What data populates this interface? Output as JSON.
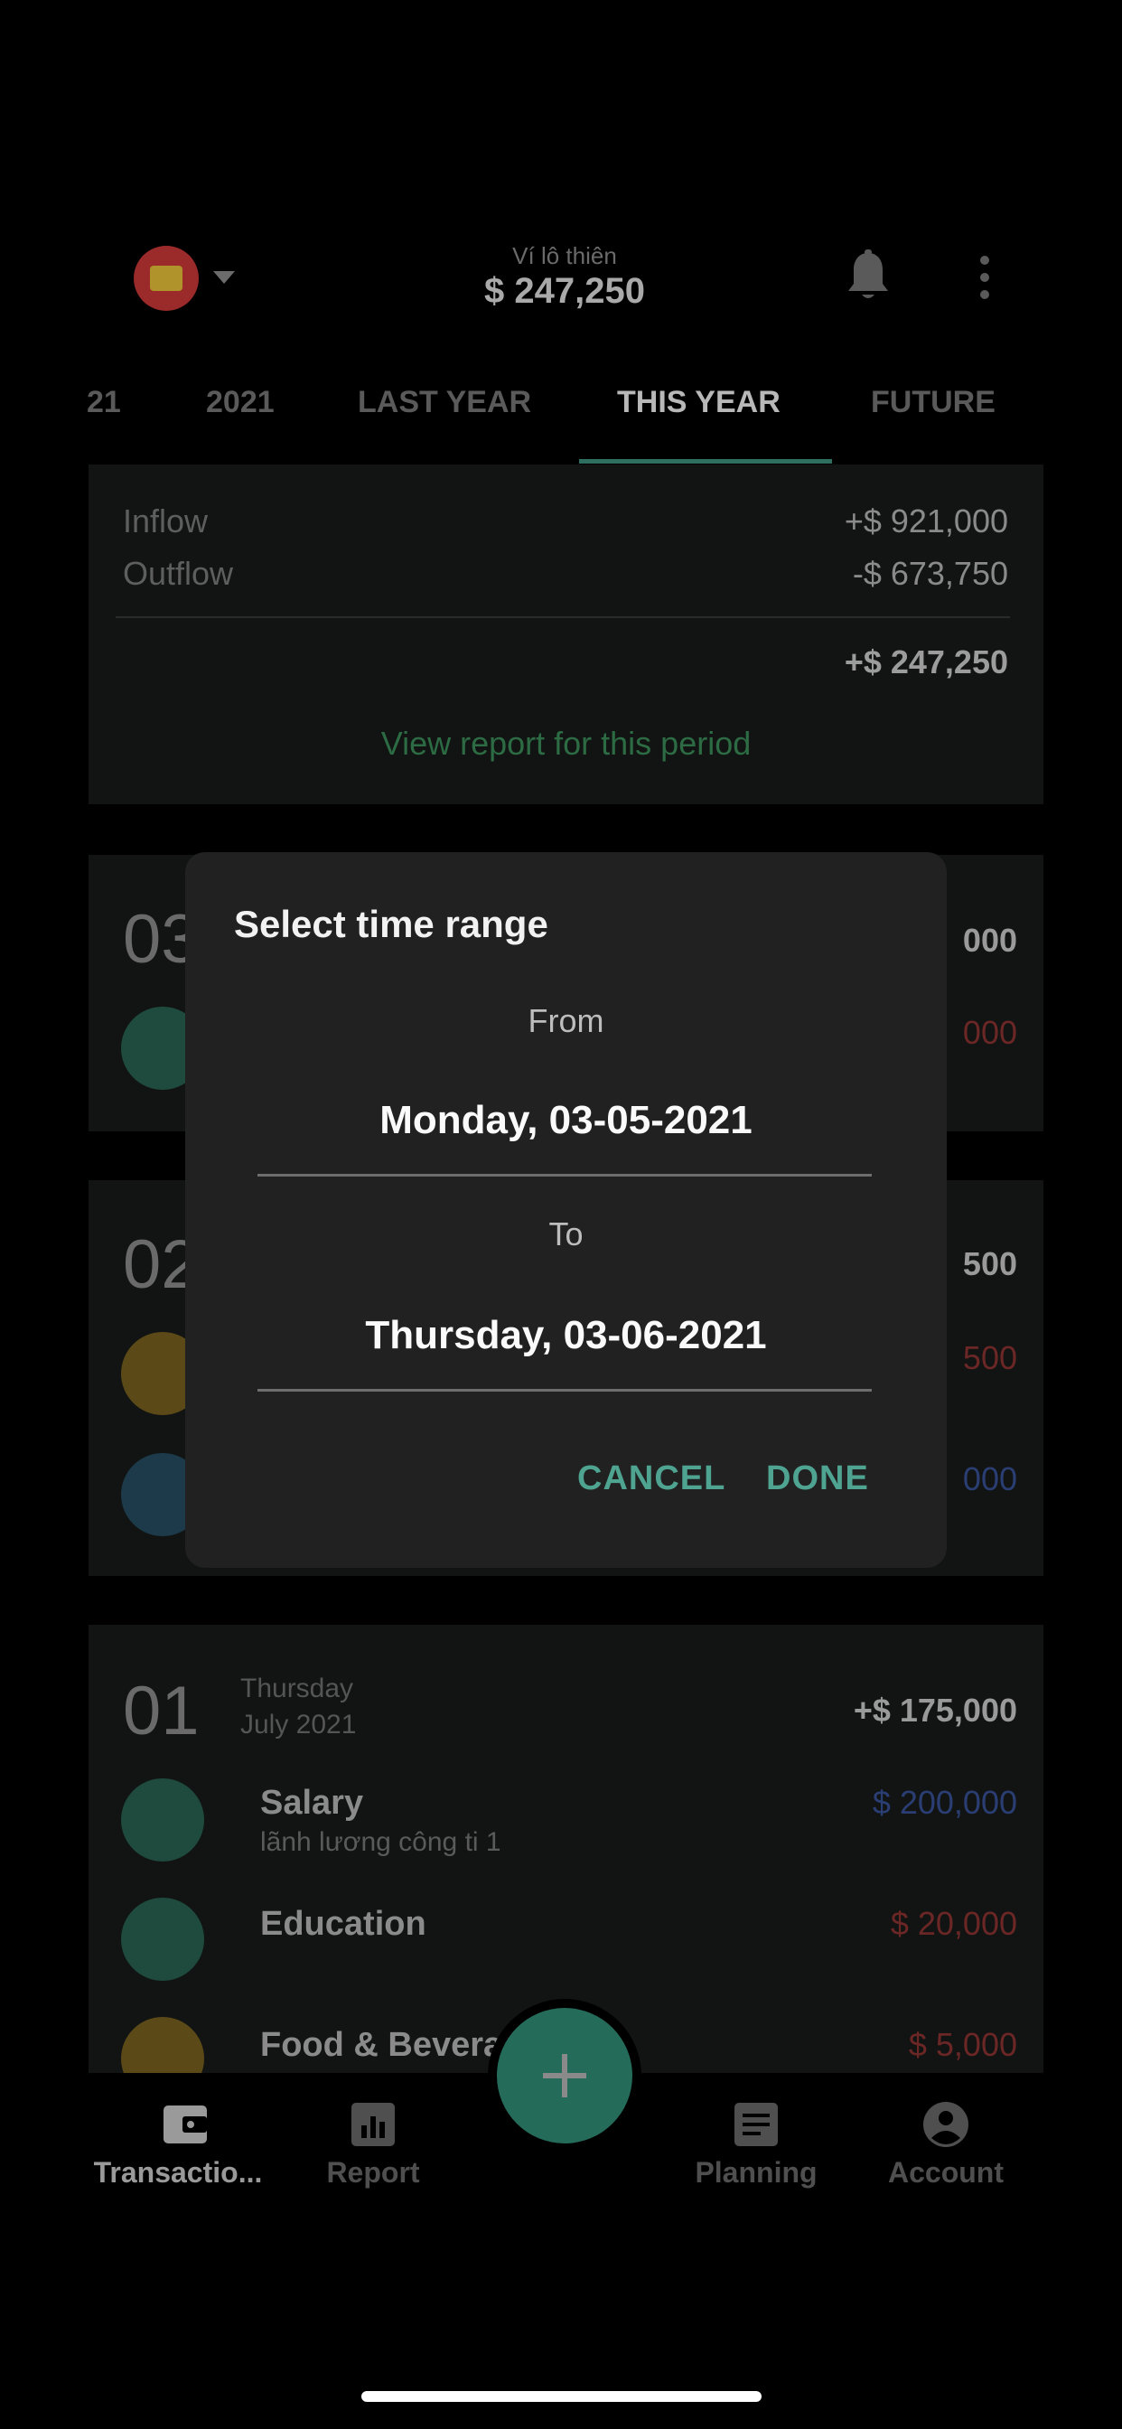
{
  "header": {
    "wallet_name": "Ví lô thiên",
    "wallet_balance": "$ 247,250"
  },
  "tabs": [
    {
      "label": "21"
    },
    {
      "label": "2021"
    },
    {
      "label": "LAST YEAR"
    },
    {
      "label": "THIS YEAR",
      "active": true
    },
    {
      "label": "FUTURE"
    }
  ],
  "summary": {
    "inflow_label": "Inflow",
    "inflow_value": "+$ 921,000",
    "outflow_label": "Outflow",
    "outflow_value": "-$ 673,750",
    "net_value": "+$ 247,250",
    "view_report": "View report for this period"
  },
  "groups": [
    {
      "day": "03",
      "total": "000",
      "items": [
        {
          "icon": "education-icon",
          "amount": "000"
        }
      ]
    },
    {
      "day": "02",
      "total": "500",
      "items": [
        {
          "icon": "food-icon",
          "amount": "500"
        },
        {
          "icon": "handshake-icon",
          "amount": "000"
        }
      ]
    },
    {
      "day": "01",
      "weekday": "Thursday",
      "month_year": "July 2021",
      "total": "+$ 175,000",
      "items": [
        {
          "icon": "salary-icon",
          "title": "Salary",
          "note": "lãnh lương công ti 1",
          "amount": "$ 200,000"
        },
        {
          "icon": "education-icon",
          "title": "Education",
          "amount": "$ 20,000"
        },
        {
          "icon": "food-icon",
          "title": "Food & Bevera",
          "amount": "$ 5,000"
        }
      ]
    }
  ],
  "nav": {
    "transactions": "Transactio...",
    "report": "Report",
    "planning": "Planning",
    "account": "Account"
  },
  "dialog": {
    "title": "Select time range",
    "from_label": "From",
    "from_date": "Monday, 03-05-2021",
    "to_label": "To",
    "to_date": "Thursday, 03-06-2021",
    "cancel": "CANCEL",
    "done": "DONE"
  },
  "colors": {
    "accent": "#4fa391",
    "dialog_bg": "#202120",
    "fab": "#246b5a"
  }
}
